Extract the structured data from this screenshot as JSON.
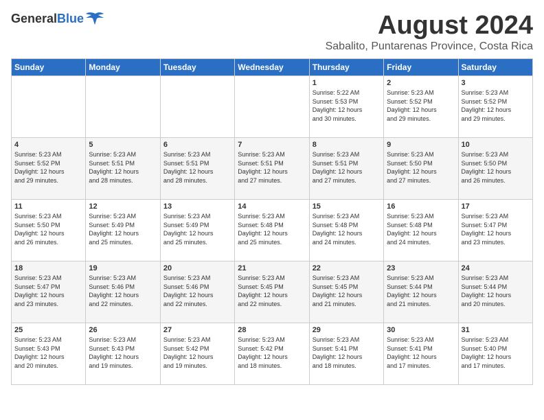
{
  "header": {
    "logo_general": "General",
    "logo_blue": "Blue",
    "month_year": "August 2024",
    "location": "Sabalito, Puntarenas Province, Costa Rica"
  },
  "days_of_week": [
    "Sunday",
    "Monday",
    "Tuesday",
    "Wednesday",
    "Thursday",
    "Friday",
    "Saturday"
  ],
  "weeks": [
    [
      {
        "day": "",
        "content": ""
      },
      {
        "day": "",
        "content": ""
      },
      {
        "day": "",
        "content": ""
      },
      {
        "day": "",
        "content": ""
      },
      {
        "day": "1",
        "content": "Sunrise: 5:22 AM\nSunset: 5:53 PM\nDaylight: 12 hours\nand 30 minutes."
      },
      {
        "day": "2",
        "content": "Sunrise: 5:23 AM\nSunset: 5:52 PM\nDaylight: 12 hours\nand 29 minutes."
      },
      {
        "day": "3",
        "content": "Sunrise: 5:23 AM\nSunset: 5:52 PM\nDaylight: 12 hours\nand 29 minutes."
      }
    ],
    [
      {
        "day": "4",
        "content": "Sunrise: 5:23 AM\nSunset: 5:52 PM\nDaylight: 12 hours\nand 29 minutes."
      },
      {
        "day": "5",
        "content": "Sunrise: 5:23 AM\nSunset: 5:51 PM\nDaylight: 12 hours\nand 28 minutes."
      },
      {
        "day": "6",
        "content": "Sunrise: 5:23 AM\nSunset: 5:51 PM\nDaylight: 12 hours\nand 28 minutes."
      },
      {
        "day": "7",
        "content": "Sunrise: 5:23 AM\nSunset: 5:51 PM\nDaylight: 12 hours\nand 27 minutes."
      },
      {
        "day": "8",
        "content": "Sunrise: 5:23 AM\nSunset: 5:51 PM\nDaylight: 12 hours\nand 27 minutes."
      },
      {
        "day": "9",
        "content": "Sunrise: 5:23 AM\nSunset: 5:50 PM\nDaylight: 12 hours\nand 27 minutes."
      },
      {
        "day": "10",
        "content": "Sunrise: 5:23 AM\nSunset: 5:50 PM\nDaylight: 12 hours\nand 26 minutes."
      }
    ],
    [
      {
        "day": "11",
        "content": "Sunrise: 5:23 AM\nSunset: 5:50 PM\nDaylight: 12 hours\nand 26 minutes."
      },
      {
        "day": "12",
        "content": "Sunrise: 5:23 AM\nSunset: 5:49 PM\nDaylight: 12 hours\nand 25 minutes."
      },
      {
        "day": "13",
        "content": "Sunrise: 5:23 AM\nSunset: 5:49 PM\nDaylight: 12 hours\nand 25 minutes."
      },
      {
        "day": "14",
        "content": "Sunrise: 5:23 AM\nSunset: 5:48 PM\nDaylight: 12 hours\nand 25 minutes."
      },
      {
        "day": "15",
        "content": "Sunrise: 5:23 AM\nSunset: 5:48 PM\nDaylight: 12 hours\nand 24 minutes."
      },
      {
        "day": "16",
        "content": "Sunrise: 5:23 AM\nSunset: 5:48 PM\nDaylight: 12 hours\nand 24 minutes."
      },
      {
        "day": "17",
        "content": "Sunrise: 5:23 AM\nSunset: 5:47 PM\nDaylight: 12 hours\nand 23 minutes."
      }
    ],
    [
      {
        "day": "18",
        "content": "Sunrise: 5:23 AM\nSunset: 5:47 PM\nDaylight: 12 hours\nand 23 minutes."
      },
      {
        "day": "19",
        "content": "Sunrise: 5:23 AM\nSunset: 5:46 PM\nDaylight: 12 hours\nand 22 minutes."
      },
      {
        "day": "20",
        "content": "Sunrise: 5:23 AM\nSunset: 5:46 PM\nDaylight: 12 hours\nand 22 minutes."
      },
      {
        "day": "21",
        "content": "Sunrise: 5:23 AM\nSunset: 5:45 PM\nDaylight: 12 hours\nand 22 minutes."
      },
      {
        "day": "22",
        "content": "Sunrise: 5:23 AM\nSunset: 5:45 PM\nDaylight: 12 hours\nand 21 minutes."
      },
      {
        "day": "23",
        "content": "Sunrise: 5:23 AM\nSunset: 5:44 PM\nDaylight: 12 hours\nand 21 minutes."
      },
      {
        "day": "24",
        "content": "Sunrise: 5:23 AM\nSunset: 5:44 PM\nDaylight: 12 hours\nand 20 minutes."
      }
    ],
    [
      {
        "day": "25",
        "content": "Sunrise: 5:23 AM\nSunset: 5:43 PM\nDaylight: 12 hours\nand 20 minutes."
      },
      {
        "day": "26",
        "content": "Sunrise: 5:23 AM\nSunset: 5:43 PM\nDaylight: 12 hours\nand 19 minutes."
      },
      {
        "day": "27",
        "content": "Sunrise: 5:23 AM\nSunset: 5:42 PM\nDaylight: 12 hours\nand 19 minutes."
      },
      {
        "day": "28",
        "content": "Sunrise: 5:23 AM\nSunset: 5:42 PM\nDaylight: 12 hours\nand 18 minutes."
      },
      {
        "day": "29",
        "content": "Sunrise: 5:23 AM\nSunset: 5:41 PM\nDaylight: 12 hours\nand 18 minutes."
      },
      {
        "day": "30",
        "content": "Sunrise: 5:23 AM\nSunset: 5:41 PM\nDaylight: 12 hours\nand 17 minutes."
      },
      {
        "day": "31",
        "content": "Sunrise: 5:23 AM\nSunset: 5:40 PM\nDaylight: 12 hours\nand 17 minutes."
      }
    ]
  ]
}
